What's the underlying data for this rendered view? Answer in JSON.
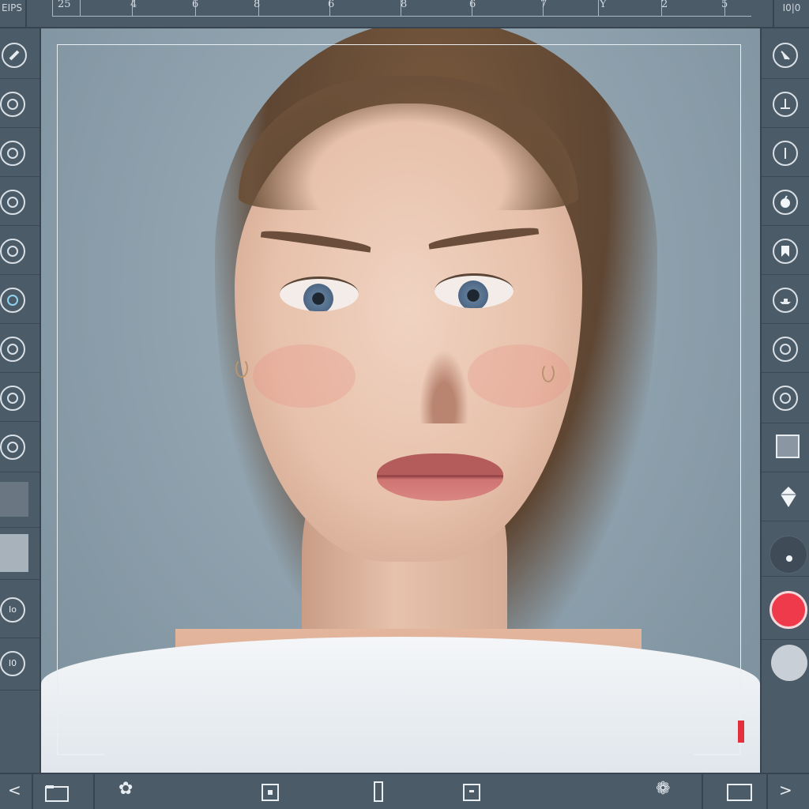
{
  "top_bar": {
    "corner_left_text": "EIPS",
    "ruler_numbers": [
      "25",
      "4",
      "6",
      "8",
      "6",
      "8",
      "6",
      "7",
      "Y",
      "2",
      "5"
    ],
    "corner_right_text": "I0|0"
  },
  "left_toolbar": {
    "items": [
      {
        "icon": "pencil-icon"
      },
      {
        "icon": "circle-tool-icon"
      },
      {
        "icon": "circle-tool-icon"
      },
      {
        "icon": "circle-tool-icon"
      },
      {
        "icon": "circle-tool-icon"
      },
      {
        "icon": "circle-tool-icon"
      },
      {
        "icon": "circle-tool-icon"
      },
      {
        "icon": "circle-tool-icon"
      },
      {
        "icon": "circle-tool-icon"
      },
      {
        "icon": "dark-swatch-icon"
      },
      {
        "icon": "light-swatch-icon"
      },
      {
        "icon": "circle-labeled-icon",
        "label": "Io"
      },
      {
        "icon": "circle-labeled-icon",
        "label": "I0"
      }
    ]
  },
  "right_toolbar": {
    "items": [
      {
        "icon": "arrow-down-right-icon"
      },
      {
        "icon": "anchor-icon"
      },
      {
        "icon": "line-icon"
      },
      {
        "icon": "apple-icon"
      },
      {
        "icon": "bookmark-icon"
      },
      {
        "icon": "boat-icon"
      },
      {
        "icon": "circle-tool-icon"
      },
      {
        "icon": "circle-tool-icon"
      },
      {
        "icon": "square-icon"
      },
      {
        "icon": "diamond-icon"
      },
      {
        "icon": "dot-icon"
      },
      {
        "icon": "record-button-icon",
        "color": "#ee3a4a"
      },
      {
        "icon": "grey-circle-icon",
        "color": "#c9cfd6"
      }
    ]
  },
  "bottom_bar": {
    "items": [
      {
        "icon": "chevron-left-icon",
        "glyph": "<"
      },
      {
        "icon": "folder-icon"
      },
      {
        "icon": "clover-icon",
        "glyph": "✿"
      },
      {
        "icon": "square-dot-icon"
      },
      {
        "icon": "tall-rect-icon"
      },
      {
        "icon": "square-dot-icon"
      },
      {
        "icon": "aperture-icon",
        "glyph": "❁"
      },
      {
        "icon": "rectangle-icon"
      },
      {
        "icon": "chevron-right-icon",
        "glyph": ">"
      }
    ]
  },
  "canvas": {
    "subject": "portrait photo",
    "background_color": "#8fa2ae",
    "crop_frame_color": "#e9eef2",
    "marker_color": "#e2303c"
  },
  "colors": {
    "toolbar_bg": "#4c5b68",
    "divider": "#38444f",
    "icon_stroke": "#d9e0e6"
  }
}
